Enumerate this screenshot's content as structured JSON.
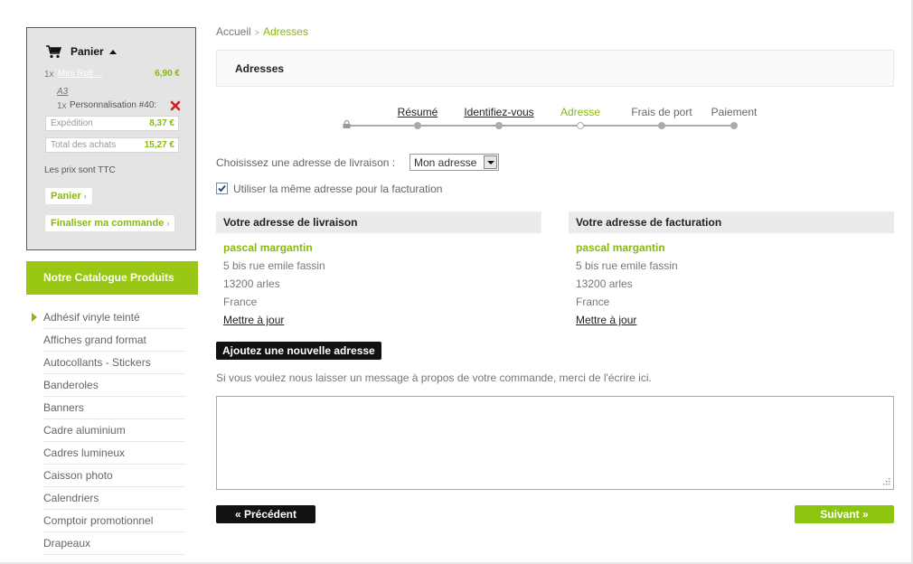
{
  "cart": {
    "title": "Panier",
    "item": {
      "qty": "1x",
      "name": "Mini Roll ...",
      "price": "6,90 €",
      "attribute": "A3"
    },
    "option": {
      "qty": "1x",
      "name": "Personnalisation #40:"
    },
    "shipping": {
      "label": "Expédition",
      "value": "8,37 €"
    },
    "total": {
      "label": "Total des achats",
      "value": "15,27 €"
    },
    "tax_note": "Les prix sont TTC",
    "cart_button": "Panier",
    "checkout_button": "Finaliser ma commande",
    "arrow": "›"
  },
  "catalog": {
    "title": "Notre Catalogue Produits",
    "items": [
      "Adhésif vinyle teinté",
      "Affiches grand format",
      "Autocollants - Stickers",
      "Banderoles",
      "Banners",
      "Cadre aluminium",
      "Cadres lumineux",
      "Caisson photo",
      "Calendriers",
      "Comptoir promotionnel",
      "Drapeaux"
    ]
  },
  "breadcrumb": {
    "home": "Accueil",
    "separator": ">",
    "current": "Adresses"
  },
  "page_title": "Adresses",
  "steps": [
    "Résumé",
    "Identifiez-vous",
    "Adresse",
    "Frais de port",
    "Paiement"
  ],
  "delivery_select": {
    "label": "Choisissez une adresse de livraison :",
    "value": "Mon adresse"
  },
  "same_address": {
    "label": "Utiliser la même adresse pour la facturation",
    "checked": true
  },
  "delivery_address": {
    "title": "Votre adresse de livraison",
    "name": "pascal margantin",
    "street": "5 bis rue emile fassin",
    "city": "13200 arles",
    "country": "France",
    "update": "Mettre à jour"
  },
  "billing_address": {
    "title": "Votre adresse de facturation",
    "name": "pascal margantin",
    "street": "5 bis rue emile fassin",
    "city": "13200 arles",
    "country": "France",
    "update": "Mettre à jour"
  },
  "add_address_button": "Ajoutez une nouvelle adresse",
  "message_label": "Si vous voulez nous laisser un message à propos de votre commande, merci de l'écrire ici.",
  "message_value": "",
  "prev_button": "« Précédent",
  "next_button": "Suivant »",
  "colors": {
    "accent": "#8ab811",
    "dark_button": "#111111",
    "green_button": "#8cc510"
  }
}
